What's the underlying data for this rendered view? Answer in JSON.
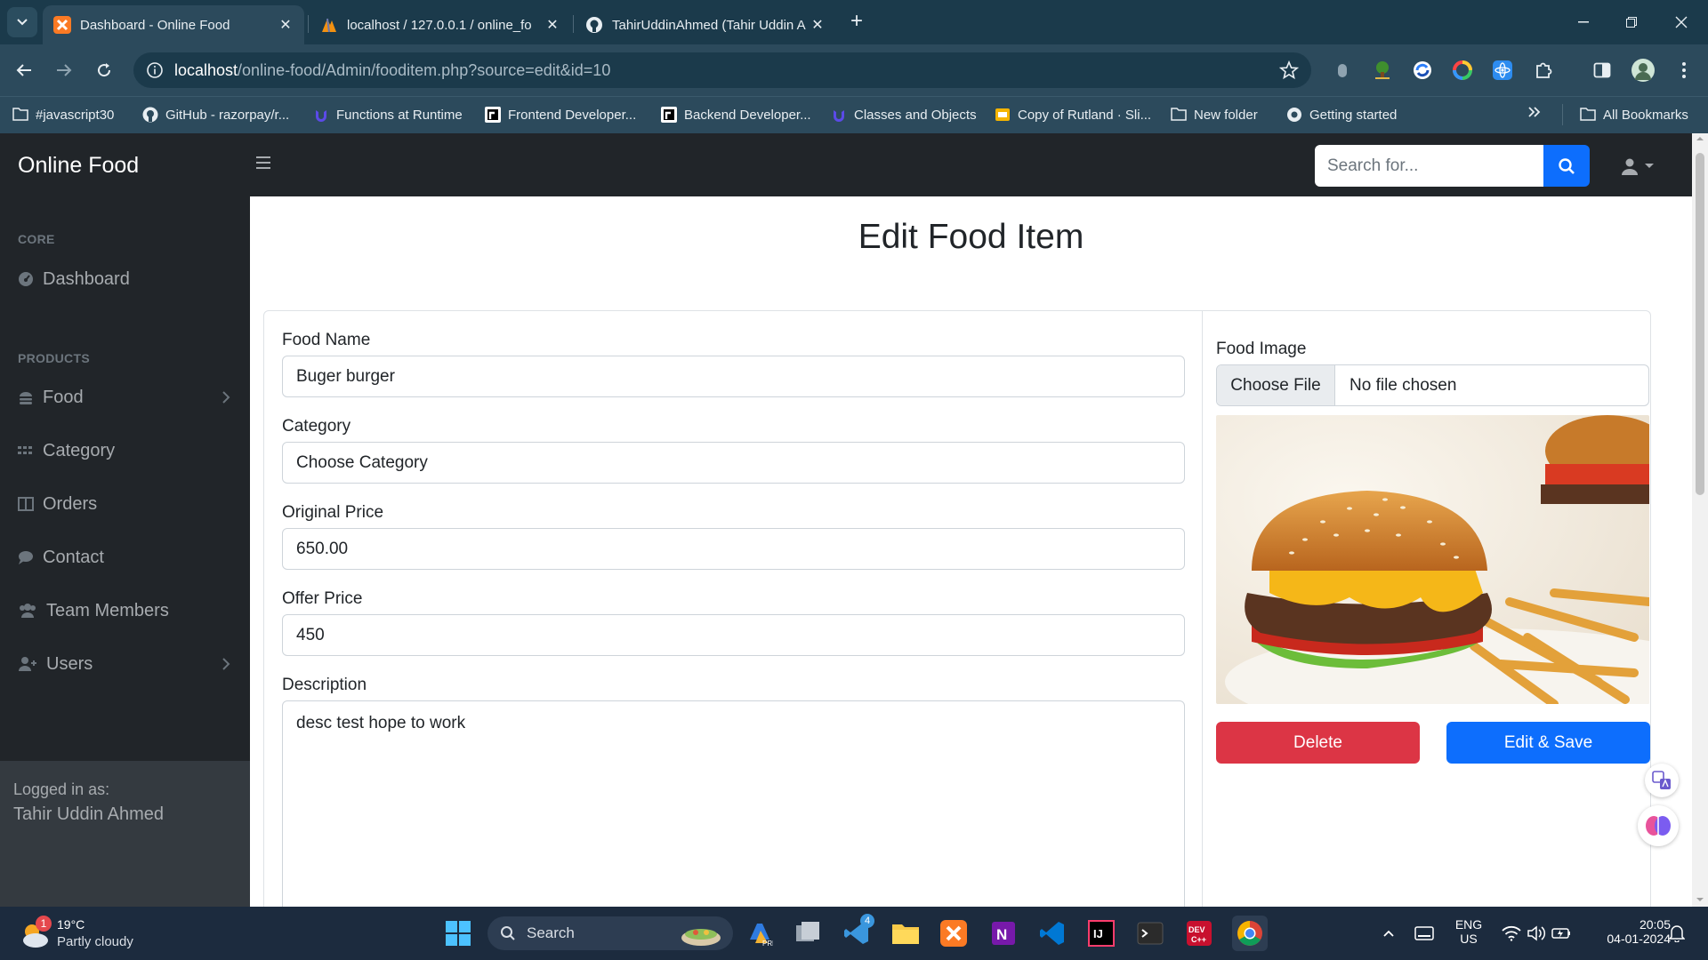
{
  "browser": {
    "tabs": [
      {
        "title": "Dashboard - Online Food",
        "active": true
      },
      {
        "title": "localhost / 127.0.0.1 / online_fo",
        "active": false
      },
      {
        "title": "TahirUddinAhmed (Tahir Uddin A",
        "active": false
      }
    ],
    "url_host": "localhost",
    "url_path": "/online-food/Admin/fooditem.php?source=edit&id=10",
    "bookmarks": [
      {
        "label": "#javascript30",
        "icon": "folder-icon"
      },
      {
        "label": "GitHub - razorpay/r...",
        "icon": "github-icon"
      },
      {
        "label": "Functions at Runtime",
        "icon": "udemy-icon"
      },
      {
        "label": "Frontend Developer...",
        "icon": "roadmap-icon"
      },
      {
        "label": "Backend Developer...",
        "icon": "roadmap-icon"
      },
      {
        "label": "Classes and Objects",
        "icon": "udemy-icon"
      },
      {
        "label": "Copy of Rutland · Sli...",
        "icon": "slides-icon"
      },
      {
        "label": "New folder",
        "icon": "folder-icon"
      },
      {
        "label": "Getting started",
        "icon": "chrome-icon"
      }
    ],
    "all_bookmarks": "All Bookmarks"
  },
  "app": {
    "brand": "Online Food",
    "search_placeholder": "Search for...",
    "sidebar": {
      "core_heading": "CORE",
      "products_heading": "PRODUCTS",
      "items": [
        {
          "label": "Dashboard",
          "icon": "tachometer-icon"
        },
        {
          "label": "Food",
          "icon": "utensils-icon"
        },
        {
          "label": "Category",
          "icon": "grid-icon"
        },
        {
          "label": "Orders",
          "icon": "columns-icon"
        },
        {
          "label": "Contact",
          "icon": "comment-icon"
        },
        {
          "label": "Team Members",
          "icon": "users-icon"
        },
        {
          "label": "Users",
          "icon": "user-plus-icon"
        }
      ],
      "footer_label": "Logged in as:",
      "footer_name": "Tahir Uddin Ahmed"
    },
    "form": {
      "title": "Edit Food Item",
      "food_name_label": "Food Name",
      "food_name_value": "Buger burger",
      "category_label": "Category",
      "category_value": "Choose Category",
      "original_price_label": "Original Price",
      "original_price_value": "650.00",
      "offer_price_label": "Offer Price",
      "offer_price_value": "450",
      "description_label": "Description",
      "description_value": "desc test hope to work",
      "image_label": "Food Image",
      "file_button": "Choose File",
      "file_status": "No file chosen",
      "delete_label": "Delete",
      "save_label": "Edit & Save"
    }
  },
  "taskbar": {
    "weather_temp": "19°C",
    "weather_desc": "Partly cloudy",
    "weather_badge": "1",
    "search_label": "Search",
    "vscode_badge": "4",
    "lang_top": "ENG",
    "lang_bottom": "US",
    "time": "20:05",
    "date": "04-01-2024"
  },
  "colors": {
    "chrome_dark": "#1b3a4b",
    "chrome_toolbar": "#2c4a5c",
    "nav_dark": "#212529",
    "primary": "#0d6efd",
    "danger": "#dc3545"
  }
}
